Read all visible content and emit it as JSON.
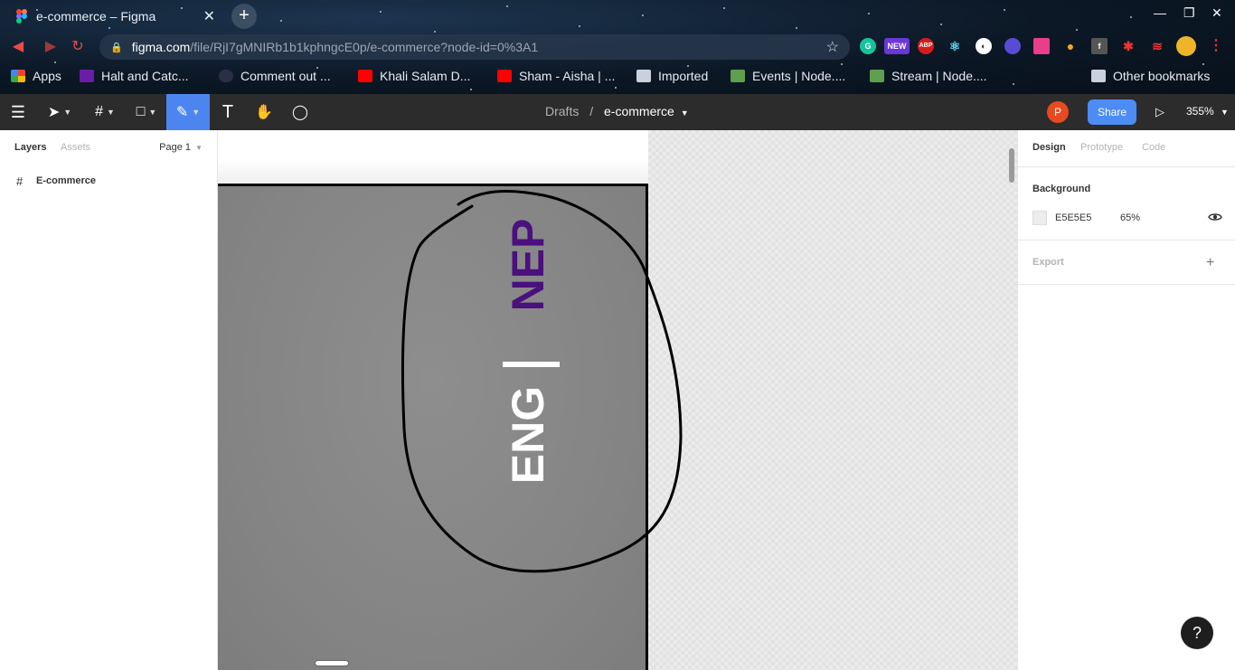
{
  "browser": {
    "tab_title": "e-commerce – Figma",
    "new_tab_label": "+",
    "url_host": "figma.com",
    "url_path": "/file/RjI7gMNIRb1b1kphngcE0p/e-commerce?node-id=0%3A1",
    "extension_badge": "NEW",
    "extension_abp": "ABP",
    "bookmarks": [
      "Apps",
      "Halt and Catc...",
      "Comment out ...",
      "Khali Salam D...",
      "Sham - Aisha | ...",
      "Imported",
      "Events | Node....",
      "Stream | Node....",
      "Other bookmarks"
    ]
  },
  "figma_toolbar": {
    "breadcrumb_parent": "Drafts",
    "breadcrumb_sep": "/",
    "file_name": "e-commerce",
    "avatar_initial": "P",
    "share_label": "Share",
    "zoom_label": "355%"
  },
  "left_panel": {
    "tab_layers": "Layers",
    "tab_assets": "Assets",
    "page_selector": "Page 1",
    "layers": [
      {
        "name": "E-commerce"
      }
    ]
  },
  "canvas": {
    "lang_nep": "NEP",
    "lang_eng": "ENG"
  },
  "right_panel": {
    "tab_design": "Design",
    "tab_prototype": "Prototype",
    "tab_code": "Code",
    "background_title": "Background",
    "background_hex": "E5E5E5",
    "background_opacity": "65%",
    "export_title": "Export"
  },
  "help_label": "?",
  "colors": {
    "accent_blue": "#4d8cf5",
    "toolbar_bg": "#2c2c2c",
    "nep_purple": "#4b0f7e",
    "avatar_orange": "#e8491f"
  }
}
